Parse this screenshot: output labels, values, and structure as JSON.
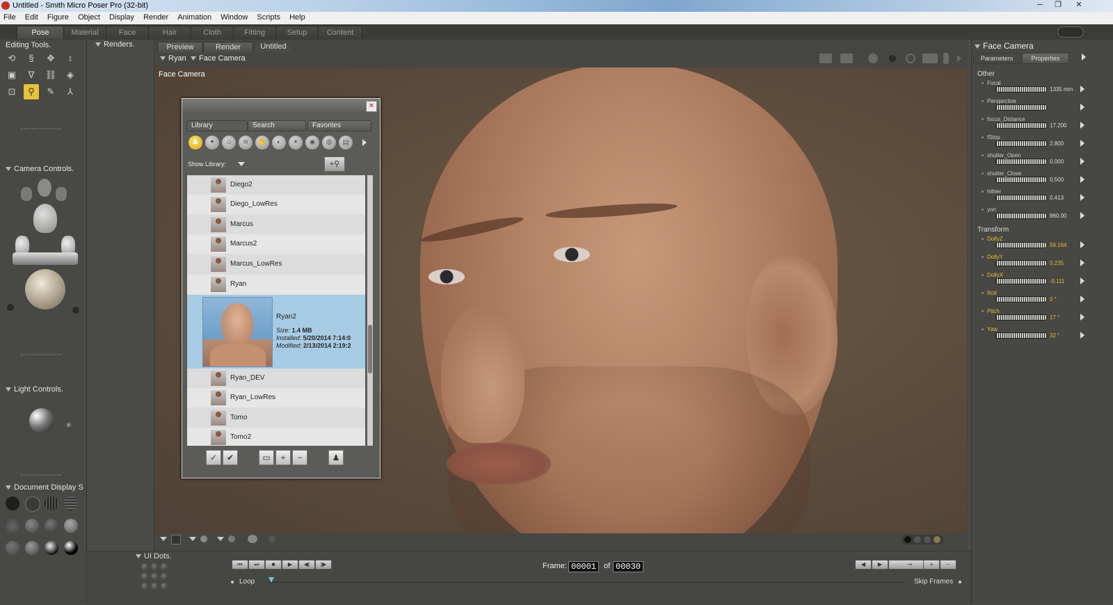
{
  "window": {
    "title": "Untitled - Smith Micro Poser Pro  (32-bit)",
    "min": "─",
    "max": "❐",
    "close": "✕"
  },
  "menu": [
    "File",
    "Edit",
    "Figure",
    "Object",
    "Display",
    "Render",
    "Animation",
    "Window",
    "Scripts",
    "Help"
  ],
  "rooms": [
    "Pose",
    "Material",
    "Face",
    "Hair",
    "Cloth",
    "Fitting",
    "Setup",
    "Content"
  ],
  "left": {
    "editing_tools": "Editing Tools.",
    "camera_controls": "Camera Controls.",
    "light_controls": "Light Controls.",
    "document_display": "Document Display S"
  },
  "renders_label": "Renders.",
  "viewport": {
    "tabs": [
      "Preview",
      "Render",
      "Untitled"
    ],
    "figure_menu": "Ryan",
    "camera_menu": "Face Camera",
    "camera_label": "Face Camera"
  },
  "library": {
    "tabs": [
      "Library",
      "Search",
      "Favorites"
    ],
    "show_library": "Show Library:",
    "items": [
      "Diego2",
      "Diego_LowRes",
      "Marcus",
      "Marcus2",
      "Marcus_LowRes",
      "Ryan"
    ],
    "selected": {
      "name": "Ryan2",
      "size_label": "Size:",
      "size": "1.4 MB",
      "installed_label": "Installed:",
      "installed": "5/20/2014 7:14:0",
      "modified_label": "Modified:",
      "modified": "2/13/2014 2:19:2"
    },
    "items_after": [
      "Ryan_DEV",
      "Ryan_LowRes",
      "Tomo",
      "Tomo2"
    ]
  },
  "parameters": {
    "title": "Face Camera",
    "tabs": [
      "Parameters",
      "Properties"
    ],
    "group_other": "Other",
    "group_transform": "Transform",
    "other": [
      {
        "name": "Focal",
        "value": "1335 mm"
      },
      {
        "name": "Perspective",
        "value": ""
      },
      {
        "name": "focus_Distance",
        "value": "17.200"
      },
      {
        "name": "fStop",
        "value": "2.800"
      },
      {
        "name": "shutter_Open",
        "value": "0.000"
      },
      {
        "name": "shutter_Close",
        "value": "0.500"
      },
      {
        "name": "hither",
        "value": "0.413"
      },
      {
        "name": "yon",
        "value": "860.00"
      }
    ],
    "transform": [
      {
        "name": "DollyZ",
        "value": "56.164"
      },
      {
        "name": "DollyY",
        "value": "0.235"
      },
      {
        "name": "DollyX",
        "value": "-0.111"
      },
      {
        "name": "Roll",
        "value": "0 °"
      },
      {
        "name": "Pitch",
        "value": "17 °"
      },
      {
        "name": "Yaw",
        "value": "32 °"
      }
    ]
  },
  "timeline": {
    "ui_dots": "UI Dots.",
    "frame_label": "Frame:",
    "frame": "00001",
    "of_label": "of",
    "total": "00030",
    "loop": "Loop",
    "skip_frames": "Skip Frames"
  },
  "colors": {
    "accent": "#e4c030",
    "selection": "#a8cbe4",
    "background": "#4a4a47"
  }
}
